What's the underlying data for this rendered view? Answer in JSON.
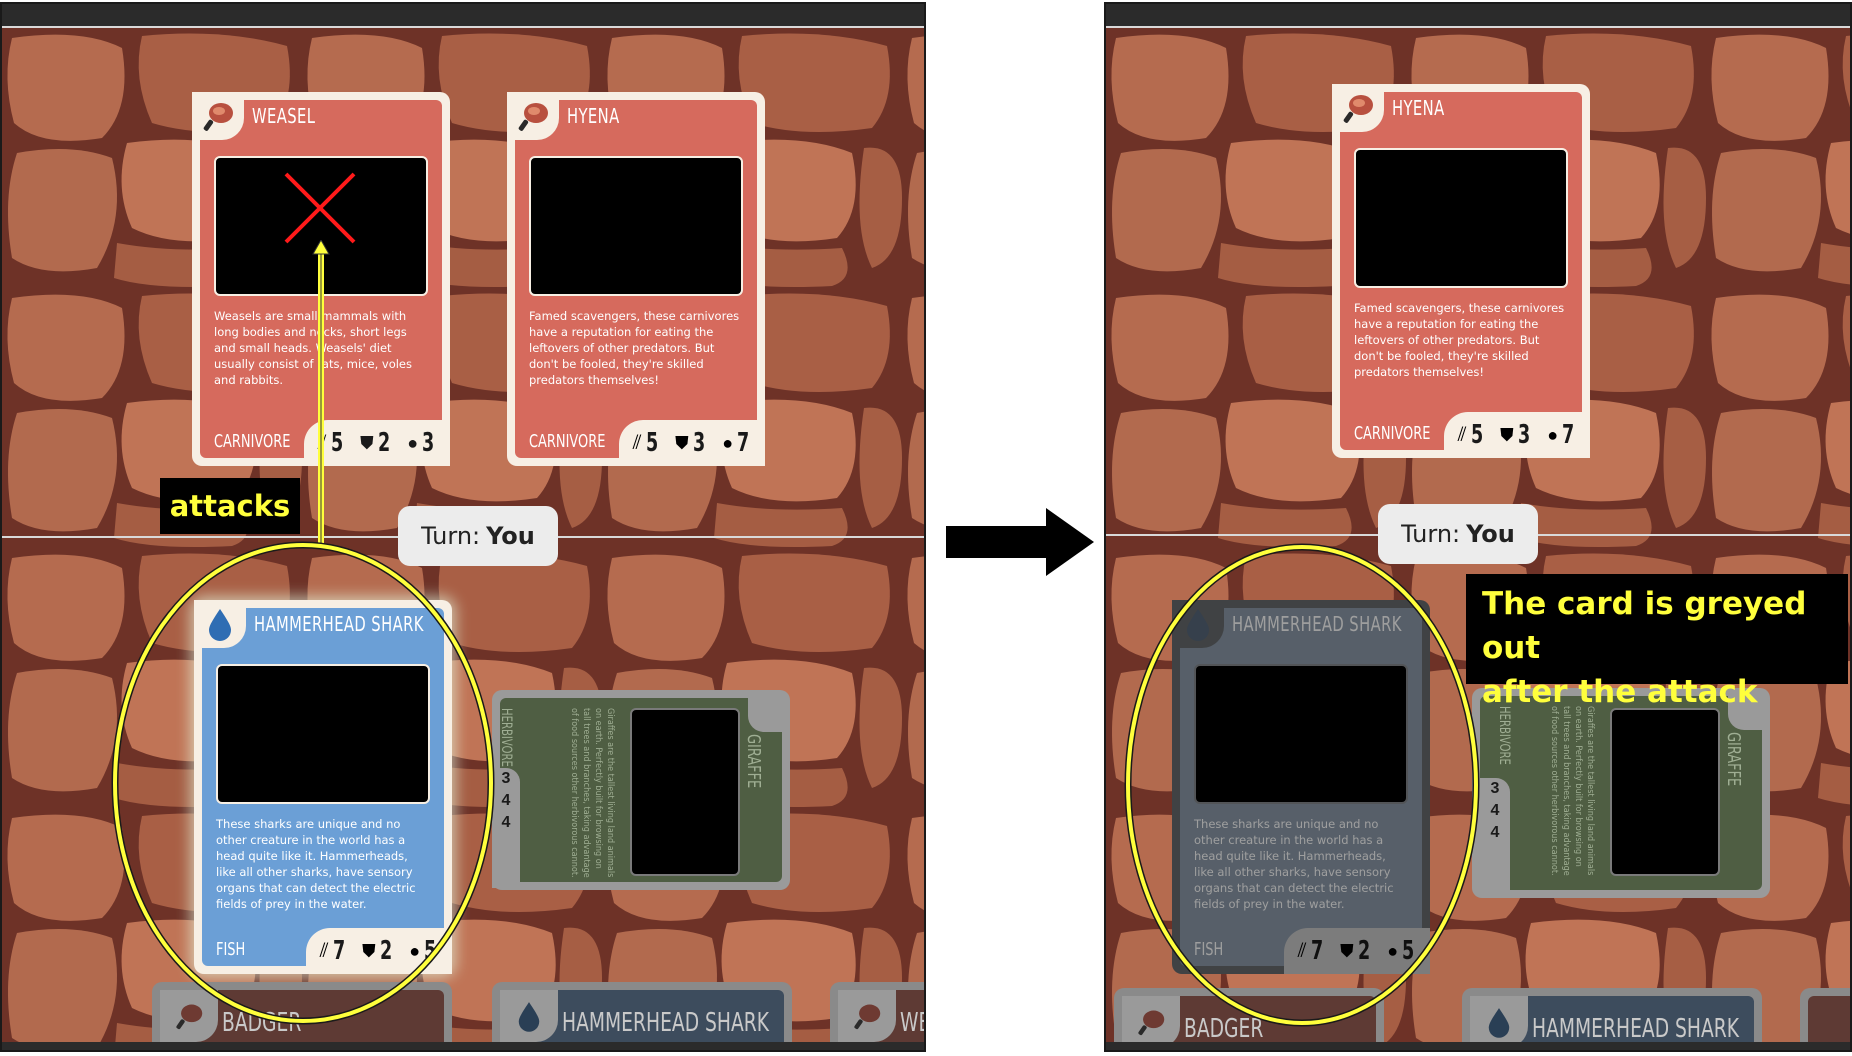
{
  "colors": {
    "carnivore": "#d66a5d",
    "fish": "#6b9fd6",
    "herbivore": "#4f5e43",
    "card_border": "#f7efe4",
    "annotation_yellow": "#ffff3c",
    "stone": "#b56b4f"
  },
  "before": {
    "enemy_cards": [
      {
        "name": "WEASEL",
        "icon": "meat-drumstick-icon",
        "description": "Weasels are small mammals with long bodies and necks, short legs and small heads. Weasels' diet usually consist of rats, mice, voles and rabbits.",
        "type": "CARNIVORE",
        "attack": "5",
        "defense": "2",
        "health": "3"
      },
      {
        "name": "HYENA",
        "icon": "meat-drumstick-icon",
        "description": "Famed scavengers, these carnivores have a reputation for eating the leftovers of other predators. But don't be fooled, they're skilled predators themselves!",
        "type": "CARNIVORE",
        "attack": "5",
        "defense": "3",
        "health": "7"
      }
    ],
    "turn_label": "Turn:",
    "turn_value": "You",
    "player_card": {
      "name": "HAMMERHEAD SHARK",
      "icon": "water-drop-icon",
      "description": "These sharks are unique and no other creature in the world has a head quite like it. Hammerheads, like all other sharks, have sensory organs that can detect the electric fields of prey in the water.",
      "type": "FISH",
      "attack": "7",
      "defense": "2",
      "health": "5"
    },
    "side_card": {
      "name": "GIRAFFE",
      "description": "Giraffes are the tallest living land animals on earth. Perfectly built for browsing on tall trees and branches, taking advantage of food sources other herbivorous cannot.",
      "type": "HERBIVORE",
      "attack": "3",
      "defense": "4",
      "health": "4"
    },
    "hand": [
      "BADGER",
      "HAMMERHEAD SHARK",
      "WE"
    ],
    "annotation": "attacks"
  },
  "after": {
    "enemy_card": {
      "name": "HYENA",
      "icon": "meat-drumstick-icon",
      "description": "Famed scavengers, these carnivores have a reputation for eating the leftovers of other predators. But don't be fooled, they're skilled predators themselves!",
      "type": "CARNIVORE",
      "attack": "5",
      "defense": "3",
      "health": "7"
    },
    "turn_label": "Turn:",
    "turn_value": "You",
    "player_card": {
      "name": "HAMMERHEAD SHARK",
      "description": "These sharks are unique and no other creature in the world has a head quite like it. Hammerheads, like all other sharks, have sensory organs that can detect the electric fields of prey in the water.",
      "type": "FISH",
      "attack": "7",
      "defense": "2",
      "health": "5"
    },
    "side_card": {
      "name": "GIRAFFE",
      "description": "Giraffes are the tallest living land animals on earth. Perfectly built for browsing on tall trees and branches, taking advantage of food sources other herbivorous cannot.",
      "type": "HERBIVORE",
      "attack": "3",
      "defense": "4",
      "health": "4"
    },
    "hand": [
      "BADGER",
      "HAMMERHEAD SHARK"
    ],
    "annotation_line1": "The card is greyed out",
    "annotation_line2": "after the attack"
  }
}
